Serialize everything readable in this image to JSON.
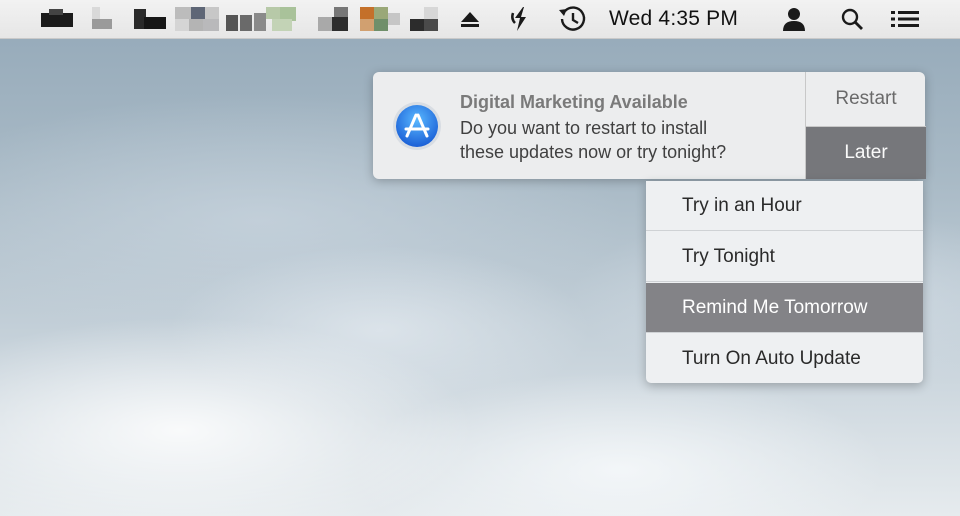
{
  "menubar": {
    "clock": "Wed 4:35 PM",
    "icons": [
      "eject-icon",
      "sync-icon",
      "time-machine-icon",
      "user-icon",
      "search-icon",
      "list-icon"
    ]
  },
  "notification": {
    "title": "Digital Marketing Available",
    "body_line1": "Do you want to restart to install",
    "body_line2": "these updates now or try tonight?",
    "restart_label": "Restart",
    "later_label": "Later",
    "app_icon": "app-store-icon"
  },
  "later_menu": {
    "items": [
      {
        "label": "Try in an Hour"
      },
      {
        "label": "Try Tonight"
      },
      {
        "label": "Remind Me Tomorrow"
      },
      {
        "label": "Turn On Auto Update"
      }
    ],
    "selected": "Remind Me Tomorrow"
  },
  "colors": {
    "later_button": "#76777b",
    "selected_item": "#838387",
    "app_icon_blue": "#1e6fe0"
  }
}
